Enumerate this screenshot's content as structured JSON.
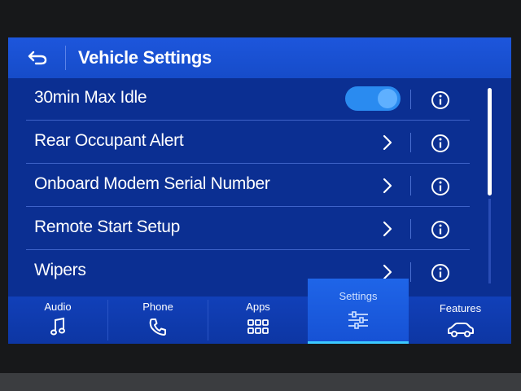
{
  "header": {
    "title": "Vehicle Settings",
    "back_icon": "back-arrow-icon"
  },
  "rows": [
    {
      "label": "30min Max Idle",
      "control": "toggle",
      "toggle_on": true
    },
    {
      "label": "Rear Occupant Alert",
      "control": "chevron"
    },
    {
      "label": "Onboard Modem Serial Number",
      "control": "chevron"
    },
    {
      "label": "Remote Start Setup",
      "control": "chevron"
    },
    {
      "label": "Wipers",
      "control": "chevron"
    }
  ],
  "nav": {
    "items": [
      {
        "label": "Audio",
        "icon": "music-note-icon"
      },
      {
        "label": "Phone",
        "icon": "phone-icon"
      },
      {
        "label": "Apps",
        "icon": "apps-grid-icon"
      },
      {
        "label": "Settings",
        "icon": "sliders-icon",
        "active": true
      },
      {
        "label": "Features",
        "icon": "car-icon"
      }
    ]
  },
  "colors": {
    "background": "#0b2f92",
    "header": "#1a52d6",
    "toggle_on": "#2a8bf0",
    "active_indicator": "#3cc9ff",
    "text": "#ffffff"
  }
}
